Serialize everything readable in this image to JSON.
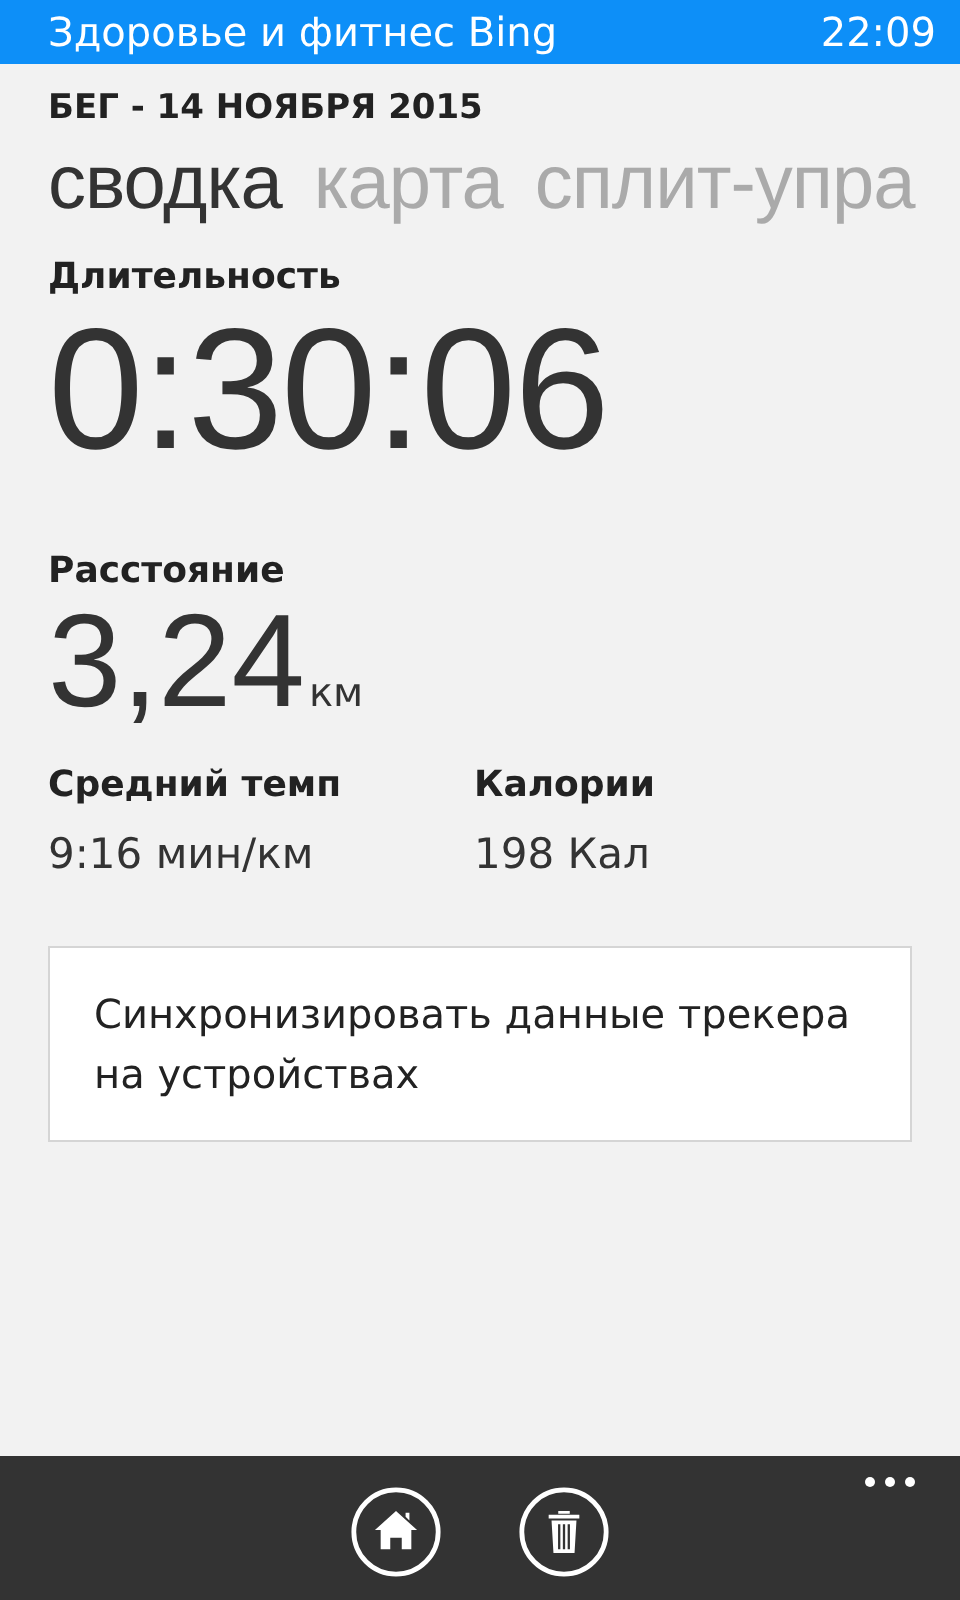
{
  "status_bar": {
    "app_title": "Здоровье и фитнес Bing",
    "time": "22:09"
  },
  "page_title": "БЕГ - 14 НОЯБРЯ 2015",
  "pivot": [
    {
      "label": "сводка",
      "selected": true
    },
    {
      "label": "карта",
      "selected": false
    },
    {
      "label": "сплит-упра",
      "selected": false
    }
  ],
  "duration": {
    "label": "Длительность",
    "value": "0:30:06"
  },
  "distance": {
    "label": "Расстояние",
    "value": "3,24",
    "unit": "км"
  },
  "stats": [
    {
      "label": "Средний темп",
      "value": "9:16 мин/км"
    },
    {
      "label": "Калории",
      "value": "198 Кал"
    }
  ],
  "sync_button": "Синхронизировать данные трекера на устройствах",
  "app_bar": {
    "buttons": [
      {
        "kind": "home"
      },
      {
        "kind": "delete"
      }
    ]
  }
}
